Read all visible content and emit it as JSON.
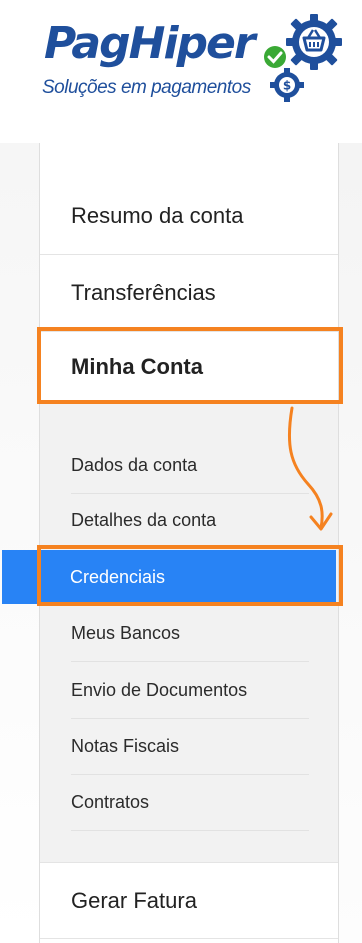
{
  "logo": {
    "brand": "PagHiper",
    "tagline": "Soluções em pagamentos",
    "brand_color": "#1f4f9c",
    "icons": [
      "gear-basket-icon",
      "check-badge-icon",
      "dollar-gear-icon"
    ]
  },
  "menu": {
    "items": [
      {
        "label": "Resumo da conta"
      },
      {
        "label": "Transferências"
      },
      {
        "label": "Minha Conta"
      },
      {
        "label": "Gerar Fatura"
      }
    ],
    "submenu": [
      {
        "label": "Dados da conta"
      },
      {
        "label": "Detalhes da conta"
      },
      {
        "label": "Credenciais",
        "active": true
      },
      {
        "label": "Meus Bancos"
      },
      {
        "label": "Envio de Documentos"
      },
      {
        "label": "Notas Fiscais"
      },
      {
        "label": "Contratos"
      }
    ]
  },
  "annotations": {
    "highlight_color": "#f58220",
    "active_color": "#2883f5",
    "arrow_icon": "curved-down-arrow-icon"
  }
}
